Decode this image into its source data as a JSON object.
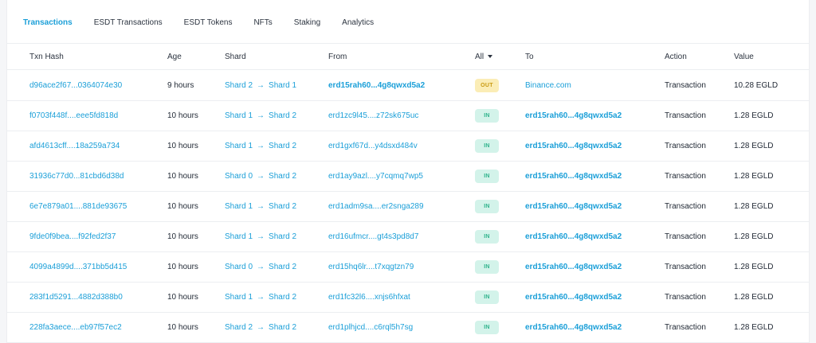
{
  "tabs": [
    {
      "label": "Transactions",
      "active": true
    },
    {
      "label": "ESDT Transactions",
      "active": false
    },
    {
      "label": "ESDT Tokens",
      "active": false
    },
    {
      "label": "NFTs",
      "active": false
    },
    {
      "label": "Staking",
      "active": false
    },
    {
      "label": "Analytics",
      "active": false
    }
  ],
  "columns": {
    "hash": "Txn Hash",
    "age": "Age",
    "shard": "Shard",
    "from": "From",
    "direction": "All",
    "to": "To",
    "action": "Action",
    "value": "Value"
  },
  "shard_arrow": "→",
  "colors": {
    "accent": "#1b9fd8",
    "in_badge": "#d3f3ea",
    "out_badge": "#fbedb6"
  },
  "rows": [
    {
      "hash": "d96ace2f67...0364074e30",
      "age": "9 hours",
      "from_shard": "Shard 2",
      "to_shard": "Shard 1",
      "from": "erd15rah60...4g8qwxd5a2",
      "from_bold": true,
      "direction": "OUT",
      "to": "Binance.com",
      "to_bold": false,
      "action": "Transaction",
      "value": "10.28 EGLD"
    },
    {
      "hash": "f0703f448f....eee5fd818d",
      "age": "10 hours",
      "from_shard": "Shard 1",
      "to_shard": "Shard 2",
      "from": "erd1zc9l45....z72sk675uc",
      "from_bold": false,
      "direction": "IN",
      "to": "erd15rah60...4g8qwxd5a2",
      "to_bold": true,
      "action": "Transaction",
      "value": "1.28 EGLD"
    },
    {
      "hash": "afd4613cff....18a259a734",
      "age": "10 hours",
      "from_shard": "Shard 1",
      "to_shard": "Shard 2",
      "from": "erd1gxf67d...y4dsxd484v",
      "from_bold": false,
      "direction": "IN",
      "to": "erd15rah60...4g8qwxd5a2",
      "to_bold": true,
      "action": "Transaction",
      "value": "1.28 EGLD"
    },
    {
      "hash": "31936c77d0...81cbd6d38d",
      "age": "10 hours",
      "from_shard": "Shard 0",
      "to_shard": "Shard 2",
      "from": "erd1ay9azl....y7cqmq7wp5",
      "from_bold": false,
      "direction": "IN",
      "to": "erd15rah60...4g8qwxd5a2",
      "to_bold": true,
      "action": "Transaction",
      "value": "1.28 EGLD"
    },
    {
      "hash": "6e7e879a01....881de93675",
      "age": "10 hours",
      "from_shard": "Shard 1",
      "to_shard": "Shard 2",
      "from": "erd1adm9sa....er2snga289",
      "from_bold": false,
      "direction": "IN",
      "to": "erd15rah60...4g8qwxd5a2",
      "to_bold": true,
      "action": "Transaction",
      "value": "1.28 EGLD"
    },
    {
      "hash": "9fde0f9bea....f92fed2f37",
      "age": "10 hours",
      "from_shard": "Shard 1",
      "to_shard": "Shard 2",
      "from": "erd16ufmcr....gt4s3pd8d7",
      "from_bold": false,
      "direction": "IN",
      "to": "erd15rah60...4g8qwxd5a2",
      "to_bold": true,
      "action": "Transaction",
      "value": "1.28 EGLD"
    },
    {
      "hash": "4099a4899d....371bb5d415",
      "age": "10 hours",
      "from_shard": "Shard 0",
      "to_shard": "Shard 2",
      "from": "erd15hq6lr....t7xqgtzn79",
      "from_bold": false,
      "direction": "IN",
      "to": "erd15rah60...4g8qwxd5a2",
      "to_bold": true,
      "action": "Transaction",
      "value": "1.28 EGLD"
    },
    {
      "hash": "283f1d5291...4882d388b0",
      "age": "10 hours",
      "from_shard": "Shard 1",
      "to_shard": "Shard 2",
      "from": "erd1fc32l6....xnjs6hfxat",
      "from_bold": false,
      "direction": "IN",
      "to": "erd15rah60...4g8qwxd5a2",
      "to_bold": true,
      "action": "Transaction",
      "value": "1.28 EGLD"
    },
    {
      "hash": "228fa3aece....eb97f57ec2",
      "age": "10 hours",
      "from_shard": "Shard 2",
      "to_shard": "Shard 2",
      "from": "erd1plhjcd....c6rql5h7sg",
      "from_bold": false,
      "direction": "IN",
      "to": "erd15rah60...4g8qwxd5a2",
      "to_bold": true,
      "action": "Transaction",
      "value": "1.28 EGLD"
    }
  ]
}
